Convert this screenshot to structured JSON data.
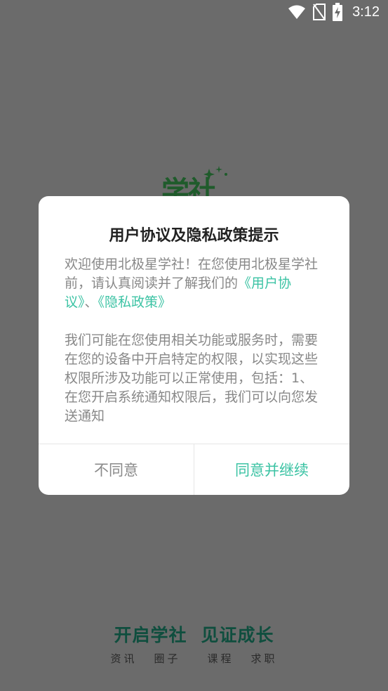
{
  "status_bar": {
    "time": "3:12",
    "icons": [
      "wifi-icon",
      "no-sim-icon",
      "battery-charging-icon"
    ]
  },
  "splash": {
    "logo_text": "学社",
    "slogan_left": "开启学社",
    "slogan_right": "见证成长",
    "tags": [
      "资讯",
      "圈子",
      "课程",
      "求职"
    ]
  },
  "dialog": {
    "title": "用户协议及隐私政策提示",
    "para1_prefix": "欢迎使用北极星学社！在您使用北极星学社前，请认真阅读并了解我们的",
    "link_user_agreement": "《用户协议》",
    "separator": "、",
    "link_privacy_policy": "《隐私政策》",
    "para2": "我们可能在您使用相关功能或服务时，需要在您的设备中开启特定的权限，以实现这些权限所涉及功能可以正常使用，包括：1、在您开启系统通知权限后，我们可以向您发送通知",
    "decline_label": "不同意",
    "accept_label": "同意并继续"
  },
  "colors": {
    "accent": "#3cc3a4",
    "overlay_bg": "#6b6b6b",
    "slogan": "#0f4e3e"
  }
}
